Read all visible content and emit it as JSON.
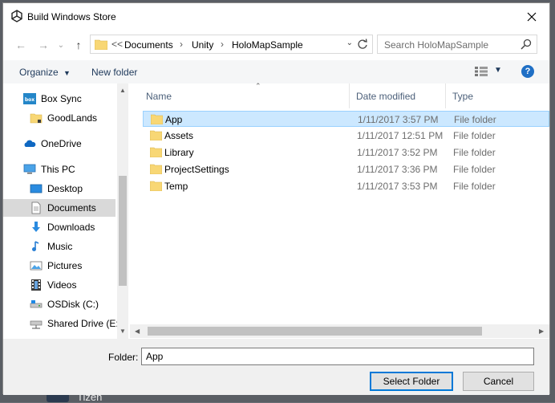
{
  "window": {
    "title": "Build Windows Store"
  },
  "address": {
    "overflow": "<<",
    "crumbs": [
      "Documents",
      "Unity",
      "HoloMapSample"
    ]
  },
  "search": {
    "placeholder": "Search HoloMapSample"
  },
  "toolbar": {
    "organize": "Organize",
    "new_folder": "New folder"
  },
  "nav": {
    "items": [
      {
        "label": "Box Sync",
        "icon": "box-sync-icon"
      },
      {
        "label": "GoodLands",
        "icon": "folder-icon"
      },
      {
        "label": "OneDrive",
        "icon": "onedrive-icon"
      },
      {
        "label": "This PC",
        "icon": "this-pc-icon"
      },
      {
        "label": "Desktop",
        "icon": "desktop-icon"
      },
      {
        "label": "Documents",
        "icon": "documents-icon",
        "selected": true
      },
      {
        "label": "Downloads",
        "icon": "downloads-icon"
      },
      {
        "label": "Music",
        "icon": "music-icon"
      },
      {
        "label": "Pictures",
        "icon": "pictures-icon"
      },
      {
        "label": "Videos",
        "icon": "videos-icon"
      },
      {
        "label": "OSDisk (C:)",
        "icon": "drive-icon"
      },
      {
        "label": "Shared Drive (E:)",
        "icon": "network-drive-icon"
      }
    ]
  },
  "columns": {
    "name": "Name",
    "date": "Date modified",
    "type": "Type"
  },
  "files": [
    {
      "name": "App",
      "date": "1/11/2017 3:57 PM",
      "type": "File folder",
      "selected": true
    },
    {
      "name": "Assets",
      "date": "1/11/2017 12:51 PM",
      "type": "File folder"
    },
    {
      "name": "Library",
      "date": "1/11/2017 3:52 PM",
      "type": "File folder"
    },
    {
      "name": "ProjectSettings",
      "date": "1/11/2017 3:36 PM",
      "type": "File folder"
    },
    {
      "name": "Temp",
      "date": "1/11/2017 3:53 PM",
      "type": "File folder"
    }
  ],
  "footer": {
    "folder_label": "Folder:",
    "folder_value": "App",
    "select_label": "Select Folder",
    "cancel_label": "Cancel"
  },
  "background": {
    "text": "Tizen"
  },
  "colors": {
    "accent": "#0078d7",
    "selection": "#cce8ff",
    "folder": "#f8d775"
  }
}
